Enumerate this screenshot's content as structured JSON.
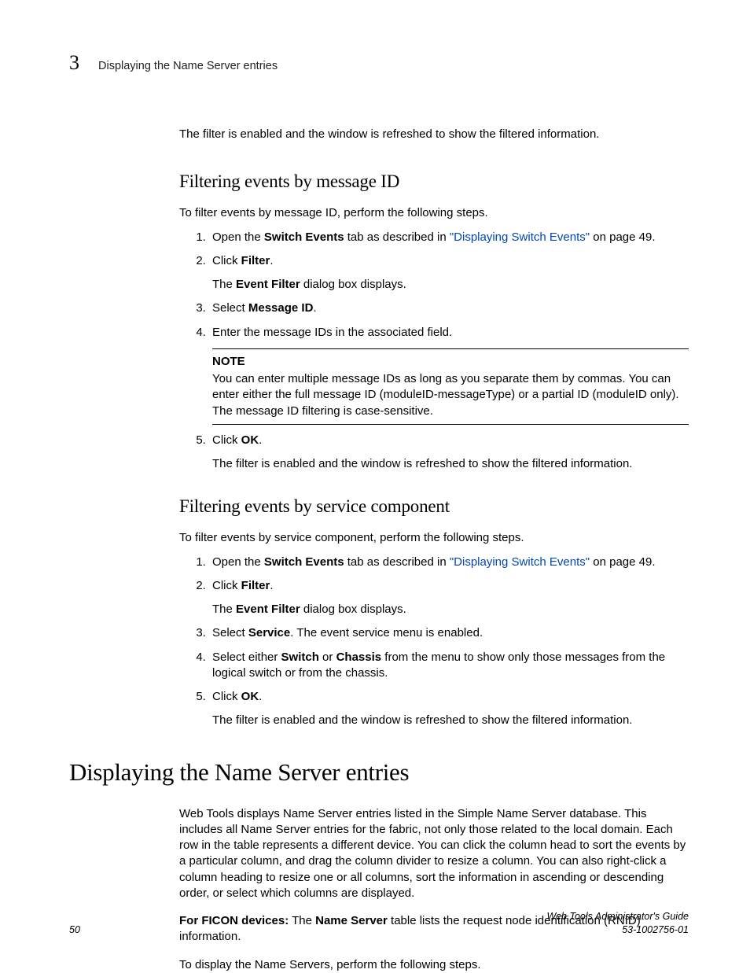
{
  "header": {
    "chapter_number": "3",
    "running_title": "Displaying the Name Server entries"
  },
  "intro_result": "The filter is enabled and the window is refreshed to show the filtered information.",
  "section1": {
    "title": "Filtering events by message ID",
    "intro": "To filter events by message ID, perform the following steps.",
    "steps": {
      "s1_pre": "Open the ",
      "s1_bold": "Switch Events",
      "s1_mid": " tab as described in ",
      "s1_link": "\"Displaying Switch Events\"",
      "s1_post": " on page 49.",
      "s2_pre": "Click ",
      "s2_bold": "Filter",
      "s2_post": ".",
      "s2_sub_pre": "The ",
      "s2_sub_bold": "Event Filter",
      "s2_sub_post": " dialog box displays.",
      "s3_pre": "Select ",
      "s3_bold": "Message ID",
      "s3_post": ".",
      "s4": "Enter the message IDs in the associated field.",
      "note_title": "NOTE",
      "note_body": "You can enter multiple message IDs as long as you separate them by commas. You can enter either the full message ID (moduleID-messageType) or a partial ID (moduleID only). The message ID filtering is case-sensitive.",
      "s5_pre": "Click ",
      "s5_bold": "OK",
      "s5_post": ".",
      "s5_sub": "The filter is enabled and the window is refreshed to show the filtered information."
    }
  },
  "section2": {
    "title": "Filtering events by service component",
    "intro": "To filter events by service component, perform the following steps.",
    "steps": {
      "s1_pre": "Open the ",
      "s1_bold": "Switch Events",
      "s1_mid": " tab as described in ",
      "s1_link": "\"Displaying Switch Events\"",
      "s1_post": " on page 49.",
      "s2_pre": "Click ",
      "s2_bold": "Filter",
      "s2_post": ".",
      "s2_sub_pre": "The ",
      "s2_sub_bold": "Event Filter",
      "s2_sub_post": " dialog box displays.",
      "s3_pre": "Select ",
      "s3_bold": "Service",
      "s3_post": ". The event service menu is enabled.",
      "s4_pre": "Select either ",
      "s4_bold1": "Switch",
      "s4_mid": " or ",
      "s4_bold2": "Chassis",
      "s4_post": " from the menu to show only those messages from the logical switch or from the chassis.",
      "s5_pre": "Click ",
      "s5_bold": "OK",
      "s5_post": ".",
      "s5_sub": "The filter is enabled and the window is refreshed to show the filtered information."
    }
  },
  "heading1": "Displaying the Name Server entries",
  "body": {
    "p1": "Web Tools displays Name Server entries listed in the Simple Name Server database. This includes all Name Server entries for the fabric, not only those related to the local domain. Each row in the table represents a different device. You can click the column head to sort the events by a particular column, and drag the column divider to resize a column. You can also right-click a column heading to resize one or all columns, sort the information in ascending or descending order, or select which columns are displayed.",
    "p2_bold1": "For FICON devices:",
    "p2_mid": " The ",
    "p2_bold2": "Name Server",
    "p2_post": " table lists the request node identification (RNID) information.",
    "p3": "To display the Name Servers, perform the following steps."
  },
  "footer": {
    "page_number": "50",
    "guide_title": "Web Tools Administrator's Guide",
    "doc_id": "53-1002756-01"
  }
}
